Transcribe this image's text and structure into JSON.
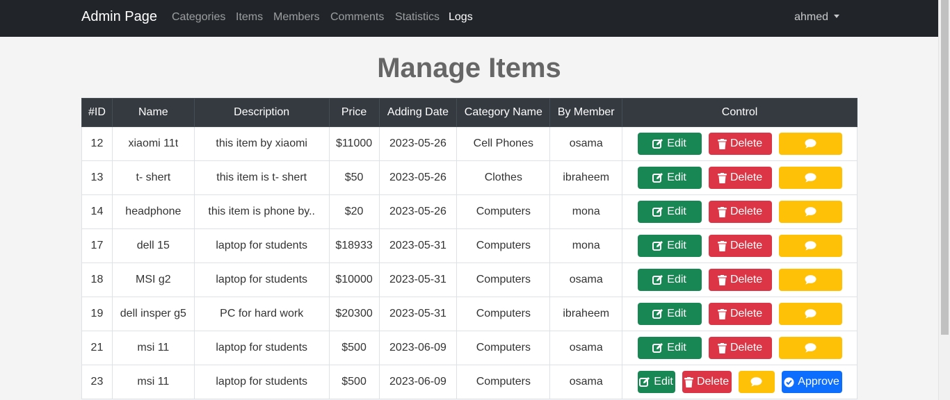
{
  "navbar": {
    "brand": "Admin Page",
    "links": [
      "Categories",
      "Items",
      "Members",
      "Comments",
      "Statistics",
      "Logs"
    ],
    "user": "ahmed"
  },
  "page": {
    "title": "Manage Items"
  },
  "table": {
    "headers": [
      "#ID",
      "Name",
      "Description",
      "Price",
      "Adding Date",
      "Category Name",
      "By Member",
      "Control"
    ],
    "rows": [
      [
        "12",
        "xiaomi 11t",
        "this item by xiaomi",
        "$11000",
        "2023-05-26",
        "Cell Phones",
        "osama"
      ],
      [
        "13",
        "t- shert",
        "this item is t- shert",
        "$50",
        "2023-05-26",
        "Clothes",
        "ibraheem"
      ],
      [
        "14",
        "headphone",
        "this item is phone by..",
        "$20",
        "2023-05-26",
        "Computers",
        "mona"
      ],
      [
        "17",
        "dell 15",
        "laptop for students",
        "$18933",
        "2023-05-31",
        "Computers",
        "mona"
      ],
      [
        "18",
        "MSI g2",
        "laptop for students",
        "$10000",
        "2023-05-31",
        "Computers",
        "osama"
      ],
      [
        "19",
        "dell insper g5",
        "PC for hard work",
        "$20300",
        "2023-05-31",
        "Computers",
        "ibraheem"
      ],
      [
        "21",
        "msi 11",
        "laptop for students",
        "$500",
        "2023-06-09",
        "Computers",
        "osama"
      ],
      [
        "23",
        "msi 11",
        "laptop for students",
        "$500",
        "2023-06-09",
        "Computers",
        "osama"
      ]
    ],
    "approve_flags": [
      false,
      false,
      false,
      false,
      false,
      false,
      false,
      true
    ]
  },
  "buttons": {
    "edit": "Edit",
    "delete": "Delete",
    "approve": "Approve"
  },
  "colors": {
    "edit": "#198754",
    "delete": "#dc3545",
    "comment": "#ffc107",
    "approve": "#0d6efd",
    "navbar": "#212529",
    "header": "#343a40"
  }
}
